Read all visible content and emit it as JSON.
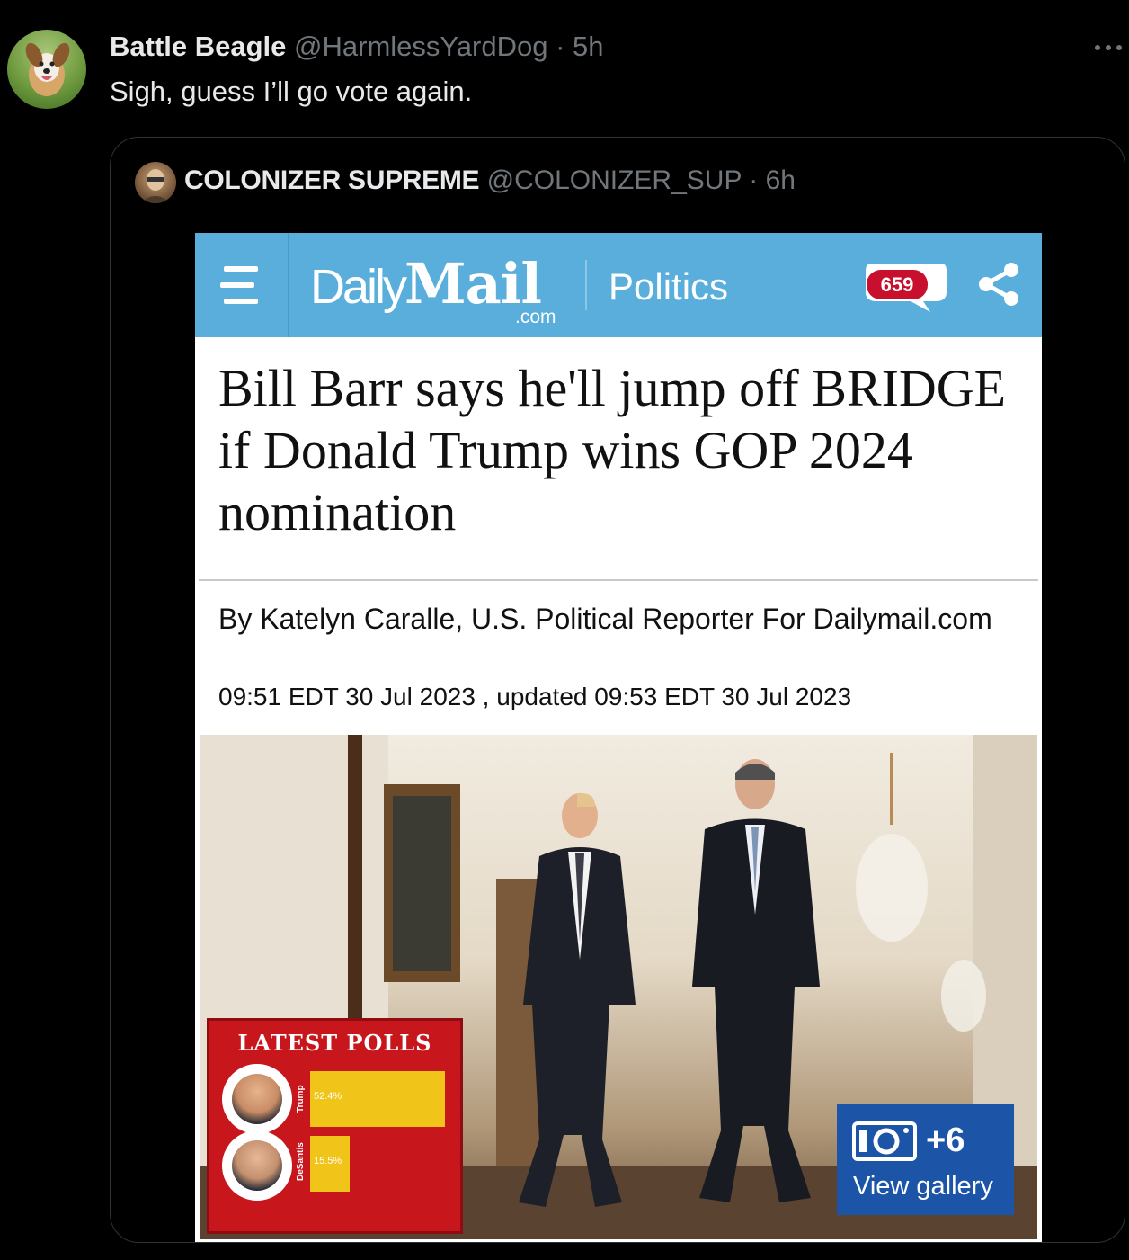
{
  "tweet": {
    "author_name": "Battle Beagle",
    "author_handle": "@HarmlessYardDog",
    "separator": "·",
    "time": "5h",
    "text": "Sigh, guess I’ll go vote again."
  },
  "quoted_tweet": {
    "author_name": "COLONIZER SUPREME",
    "author_handle": "@COLONIZER_SUP",
    "separator": "·",
    "time": "6h"
  },
  "article": {
    "brand_daily": "Daily",
    "brand_mail": "Mail",
    "brand_com": ".com",
    "section": "Politics",
    "comment_count": "659",
    "headline": "Bill Barr says he'll jump off BRIDGE if Donald Trump wins GOP 2024 nomination",
    "byline": "By Katelyn Caralle, U.S. Political Reporter For Dailymail.com",
    "dateline": "09:51 EDT 30 Jul 2023 , updated 09:53 EDT 30 Jul 2023",
    "polls_box": {
      "title": "LATEST POLLS",
      "rows": [
        {
          "name": "Trump",
          "value": "52.4%",
          "share": 52.4
        },
        {
          "name": "DeSantis",
          "value": "15.5%",
          "share": 15.5
        }
      ]
    },
    "gallery": {
      "count": "+6",
      "label": "View gallery"
    }
  },
  "colors": {
    "background": "#000000",
    "dm_header": "#5aaedc",
    "comment_badge": "#c8102e",
    "polls_box": "#c8161d",
    "poll_bar": "#f0c419",
    "gallery_button": "#1c55a8"
  },
  "icons": [
    "more-horizontal-icon",
    "hamburger-menu-icon",
    "comment-bubble-icon",
    "share-icon",
    "camera-icon"
  ]
}
